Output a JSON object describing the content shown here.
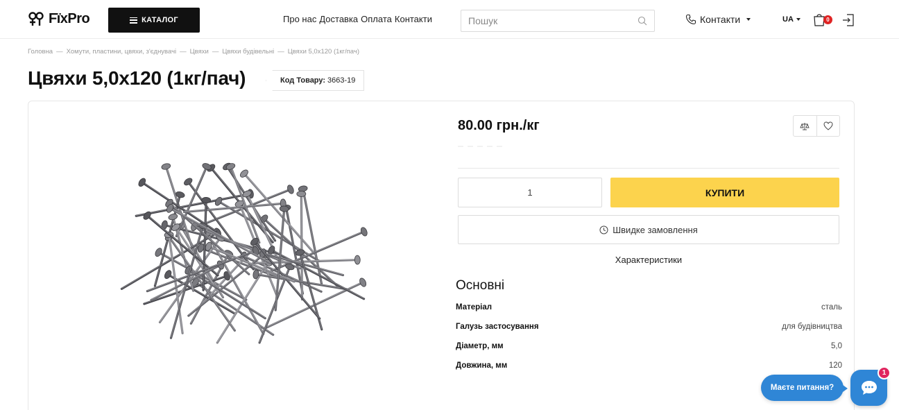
{
  "header": {
    "logo_text": "FïxPro",
    "catalog_label": "КАТАЛОГ",
    "nav": [
      "Про нас",
      "Доставка",
      "Оплата",
      "Контакти"
    ],
    "search_placeholder": "Пошук",
    "contacts_label": "Контакти",
    "lang": "UA",
    "cart_count": "0"
  },
  "breadcrumb": [
    "Головна",
    "Хомути, пластини, цвяхи, з'єднувачі",
    "Цвяхи",
    "Цвяхи будівельні",
    "Цвяхи 5,0x120 (1кг/пач)"
  ],
  "breadcrumb_separator": "—",
  "product": {
    "title": "Цвяхи 5,0х120 (1кг/пач)",
    "sku_label": "Код Товару:",
    "sku_value": "3663-19",
    "price": "80.00 грн./кг",
    "quantity": "1",
    "buy_label": "КУПИТИ",
    "quick_order_label": "Швидке замовлення",
    "specs_tab_label": "Характеристики",
    "specs_heading": "Основні",
    "specs": [
      {
        "key": "Матеріал",
        "value": "сталь"
      },
      {
        "key": "Галузь застосування",
        "value": "для будівництва"
      },
      {
        "key": "Діаметр, мм",
        "value": "5,0"
      },
      {
        "key": "Довжина, мм",
        "value": "120"
      }
    ]
  },
  "chat": {
    "bubble_text": "Маєте питання?",
    "badge": "1"
  },
  "colors": {
    "accent_buy": "#fcd34d",
    "catalog_bg": "#111111",
    "chat_blue": "#2f86d6",
    "badge_red": "#e02424"
  }
}
